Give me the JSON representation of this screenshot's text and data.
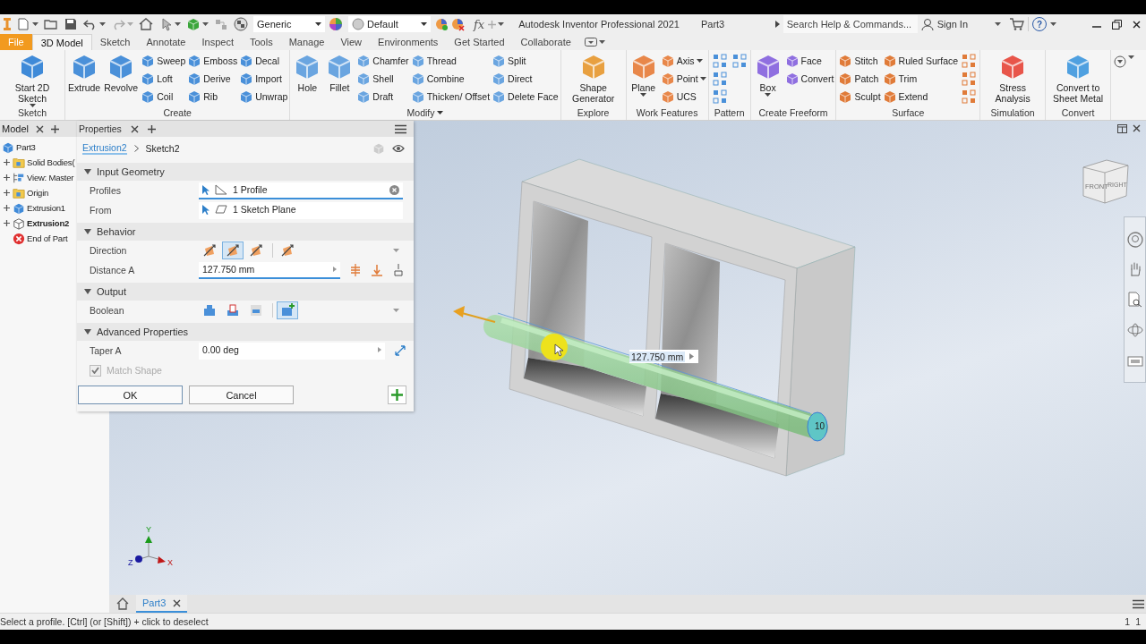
{
  "quick_access": {
    "material": "Generic",
    "appearance": "Default",
    "parameters": "fx"
  },
  "title_bar": {
    "app_title": "Autodesk Inventor Professional 2021",
    "document": "Part3",
    "search": {
      "placeholder": "Search Help & Commands..."
    },
    "sign_in": "Sign In",
    "help": "?"
  },
  "ribbon_tabs": [
    {
      "label": "File",
      "kind": "app",
      "selected": false
    },
    {
      "label": "3D Model",
      "kind": "tab",
      "selected": true
    },
    {
      "label": "Sketch",
      "kind": "tab",
      "selected": false
    },
    {
      "label": "Annotate",
      "kind": "tab",
      "selected": false
    },
    {
      "label": "Inspect",
      "kind": "tab",
      "selected": false
    },
    {
      "label": "Tools",
      "kind": "tab",
      "selected": false
    },
    {
      "label": "Manage",
      "kind": "tab",
      "selected": false
    },
    {
      "label": "View",
      "kind": "tab",
      "selected": false
    },
    {
      "label": "Environments",
      "kind": "tab",
      "selected": false
    },
    {
      "label": "Get Started",
      "kind": "tab",
      "selected": false
    },
    {
      "label": "Collaborate",
      "kind": "tab",
      "selected": false
    }
  ],
  "ribbon_groups": [
    {
      "label": "Sketch",
      "menu": false,
      "columns": [
        [
          {
            "kind": "large",
            "label": "Start 2D Sketch",
            "dropdown": true
          }
        ]
      ]
    },
    {
      "label": "Create",
      "menu": false,
      "columns": [
        [
          {
            "kind": "large",
            "label": "Extrude",
            "dropdown": false
          }
        ],
        [
          {
            "kind": "large",
            "label": "Revolve",
            "dropdown": false
          }
        ],
        [
          {
            "kind": "small",
            "label": "Sweep",
            "dropdown": false
          },
          {
            "kind": "small",
            "label": "Loft",
            "dropdown": false
          },
          {
            "kind": "small",
            "label": "Coil",
            "dropdown": false
          }
        ],
        [
          {
            "kind": "small",
            "label": "Emboss",
            "dropdown": false
          },
          {
            "kind": "small",
            "label": "Derive",
            "dropdown": false
          },
          {
            "kind": "small",
            "label": "Rib",
            "dropdown": false
          }
        ],
        [
          {
            "kind": "small",
            "label": "Decal",
            "dropdown": false
          },
          {
            "kind": "small",
            "label": "Import",
            "dropdown": false
          },
          {
            "kind": "small",
            "label": "Unwrap",
            "dropdown": false
          }
        ]
      ]
    },
    {
      "label": "Modify",
      "menu": true,
      "columns": [
        [
          {
            "kind": "large",
            "label": "Hole",
            "dropdown": false
          }
        ],
        [
          {
            "kind": "large",
            "label": "Fillet",
            "dropdown": false
          }
        ],
        [
          {
            "kind": "small",
            "label": "Chamfer",
            "dropdown": false
          },
          {
            "kind": "small",
            "label": "Shell",
            "dropdown": false
          },
          {
            "kind": "small",
            "label": "Draft",
            "dropdown": false
          }
        ],
        [
          {
            "kind": "small",
            "label": "Thread",
            "dropdown": false
          },
          {
            "kind": "small",
            "label": "Combine",
            "dropdown": false
          },
          {
            "kind": "small",
            "label": "Thicken/ Offset",
            "dropdown": false
          }
        ],
        [
          {
            "kind": "small",
            "label": "Split",
            "dropdown": false
          },
          {
            "kind": "small",
            "label": "Direct",
            "dropdown": false
          },
          {
            "kind": "small",
            "label": "Delete Face",
            "dropdown": false
          }
        ]
      ]
    },
    {
      "label": "Explore",
      "menu": false,
      "columns": [
        [
          {
            "kind": "large",
            "label": "Shape Generator",
            "dropdown": false
          }
        ]
      ]
    },
    {
      "label": "Work Features",
      "menu": false,
      "columns": [
        [
          {
            "kind": "large",
            "label": "Plane",
            "dropdown": true
          }
        ],
        [
          {
            "kind": "small",
            "label": "Axis",
            "dropdown": true
          },
          {
            "kind": "small",
            "label": "Point",
            "dropdown": true
          },
          {
            "kind": "small",
            "label": "UCS",
            "dropdown": false
          }
        ]
      ]
    },
    {
      "label": "Pattern",
      "menu": false,
      "columns": [
        [
          {
            "kind": "icon"
          },
          {
            "kind": "icon"
          },
          {
            "kind": "icon"
          }
        ],
        [
          {
            "kind": "icon"
          }
        ]
      ]
    },
    {
      "label": "Create Freeform",
      "menu": false,
      "columns": [
        [
          {
            "kind": "large",
            "label": "Box",
            "dropdown": true
          }
        ],
        [
          {
            "kind": "small",
            "label": "Face",
            "dropdown": false
          },
          {
            "kind": "small",
            "label": "Convert",
            "dropdown": false
          }
        ]
      ]
    },
    {
      "label": "Surface",
      "menu": false,
      "columns": [
        [
          {
            "kind": "small",
            "label": "Stitch",
            "dropdown": false
          },
          {
            "kind": "small",
            "label": "Patch",
            "dropdown": false
          },
          {
            "kind": "small",
            "label": "Sculpt",
            "dropdown": false
          }
        ],
        [
          {
            "kind": "small",
            "label": "Ruled Surface",
            "dropdown": false
          },
          {
            "kind": "small",
            "label": "Trim",
            "dropdown": false
          },
          {
            "kind": "small",
            "label": "Extend",
            "dropdown": false
          }
        ],
        [
          {
            "kind": "icon"
          },
          {
            "kind": "icon"
          },
          {
            "kind": "icon"
          }
        ]
      ]
    },
    {
      "label": "Simulation",
      "menu": false,
      "columns": [
        [
          {
            "kind": "large",
            "label": "Stress Analysis",
            "dropdown": false
          }
        ]
      ]
    },
    {
      "label": "Convert",
      "menu": false,
      "columns": [
        [
          {
            "kind": "large",
            "label": "Convert to Sheet Metal",
            "dropdown": false
          }
        ]
      ]
    }
  ],
  "browser": {
    "tabs": [
      {
        "label": "Model",
        "selected": true
      }
    ],
    "tree": [
      {
        "label": "Part3",
        "kind": "part",
        "active": false,
        "children": [
          {
            "label": "Solid Bodies(",
            "kind": "folder",
            "expandable": true,
            "active": false
          },
          {
            "label": "View: Master",
            "kind": "view",
            "expandable": true,
            "active": false
          },
          {
            "label": "Origin",
            "kind": "folder",
            "expandable": true,
            "active": false
          },
          {
            "label": "Extrusion1",
            "kind": "feature",
            "expandable": true,
            "active": false
          },
          {
            "label": "Extrusion2",
            "kind": "feature",
            "expandable": true,
            "active": true
          },
          {
            "label": "End of Part",
            "kind": "end",
            "expandable": false,
            "active": false
          }
        ]
      }
    ]
  },
  "properties": {
    "tabs": [
      {
        "label": "Properties",
        "selected": true
      }
    ],
    "breadcrumb": {
      "feature": "Extrusion2",
      "sketch": "Sketch2"
    },
    "sections": [
      {
        "title": "Input Geometry",
        "expanded": true,
        "rows": [
          {
            "kind": "selector",
            "label": "Profiles",
            "value": "1 Profile",
            "active": true,
            "clearable": true
          },
          {
            "kind": "selector",
            "label": "From",
            "value": "1 Sketch Plane",
            "active": false,
            "clearable": false
          }
        ]
      },
      {
        "title": "Behavior",
        "expanded": true,
        "rows": [
          {
            "kind": "direction-toggles",
            "label": "Direction",
            "options": [
              {
                "selected": false
              },
              {
                "selected": true
              },
              {
                "selected": false
              },
              {
                "selected": false
              }
            ]
          },
          {
            "kind": "distance",
            "label": "Distance A",
            "value": "127.750 mm",
            "active": true
          }
        ]
      },
      {
        "title": "Output",
        "expanded": true,
        "rows": [
          {
            "kind": "boolean-toggles",
            "label": "Boolean",
            "options": [
              {
                "selected": false
              },
              {
                "selected": false
              },
              {
                "selected": false
              },
              {
                "selected": true
              }
            ]
          }
        ]
      },
      {
        "title": "Advanced Properties",
        "expanded": true,
        "rows": [
          {
            "kind": "angle",
            "label": "Taper A",
            "value": "0.00 deg",
            "active": false
          },
          {
            "kind": "checkbox",
            "label": "Match Shape",
            "checked": true,
            "disabled": true
          }
        ]
      }
    ],
    "buttons": [
      {
        "label": "OK",
        "default": true
      },
      {
        "label": "Cancel",
        "default": false
      }
    ]
  },
  "viewport": {
    "dimension": "127.750 mm",
    "profile_label": "10",
    "view_cube": {
      "front": "FRONT",
      "right": "RIGHT"
    },
    "triad": {
      "x": "X",
      "y": "Y",
      "z": "Z"
    }
  },
  "doc_tabs": [
    {
      "label": "Part3",
      "selected": true
    }
  ],
  "status_bar": {
    "prompt": "Select a profile. [Ctrl] (or [Shift]) + click to deselect",
    "count_1": "1",
    "count_2": "1"
  }
}
